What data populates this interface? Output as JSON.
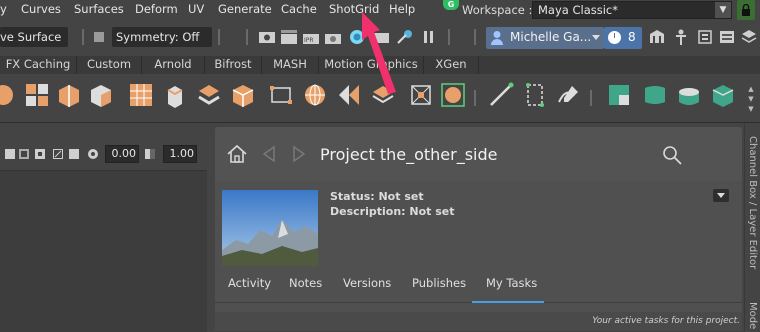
{
  "menubar": {
    "items": [
      "y",
      "Curves",
      "Surfaces",
      "Deform",
      "UV",
      "Generate",
      "Cache",
      "ShotGrid",
      "Help"
    ],
    "shotgrid_badge": "G",
    "workspace_label": "Workspace :",
    "workspace_value": "Maya Classic*"
  },
  "toolbar": {
    "surface_mode": "ve Surface",
    "symmetry": "Symmetry: Off",
    "user_name": "Michelle Ga...",
    "notification_count": "8"
  },
  "shelf": {
    "tabs": [
      "FX Caching",
      "Custom",
      "Arnold",
      "Bifrost",
      "MASH",
      "Motion Graphics",
      "XGen"
    ]
  },
  "viewport_toolbar": {
    "value_1": "0.00",
    "value_2": "1.00"
  },
  "shotgrid_panel": {
    "project_title": "Project the_other_side",
    "status": "Status: Not set",
    "description": "Description: Not set",
    "tabs": [
      "Activity",
      "Notes",
      "Versions",
      "Publishes",
      "My Tasks"
    ],
    "active_tab": "My Tasks",
    "footer": "Your active tasks for this project."
  },
  "right_strip": {
    "channel_box": "Channel Box / Layer Editor",
    "modeling": "Mode"
  },
  "colors": {
    "annotation_arrow": "#f0316e",
    "active_tab_underline": "#46a0e0",
    "user_field": "#5a6f8c",
    "notification": "#4c74a8",
    "shotgrid_badge": "#2fbf63",
    "lock_button": "#3b6e33"
  }
}
